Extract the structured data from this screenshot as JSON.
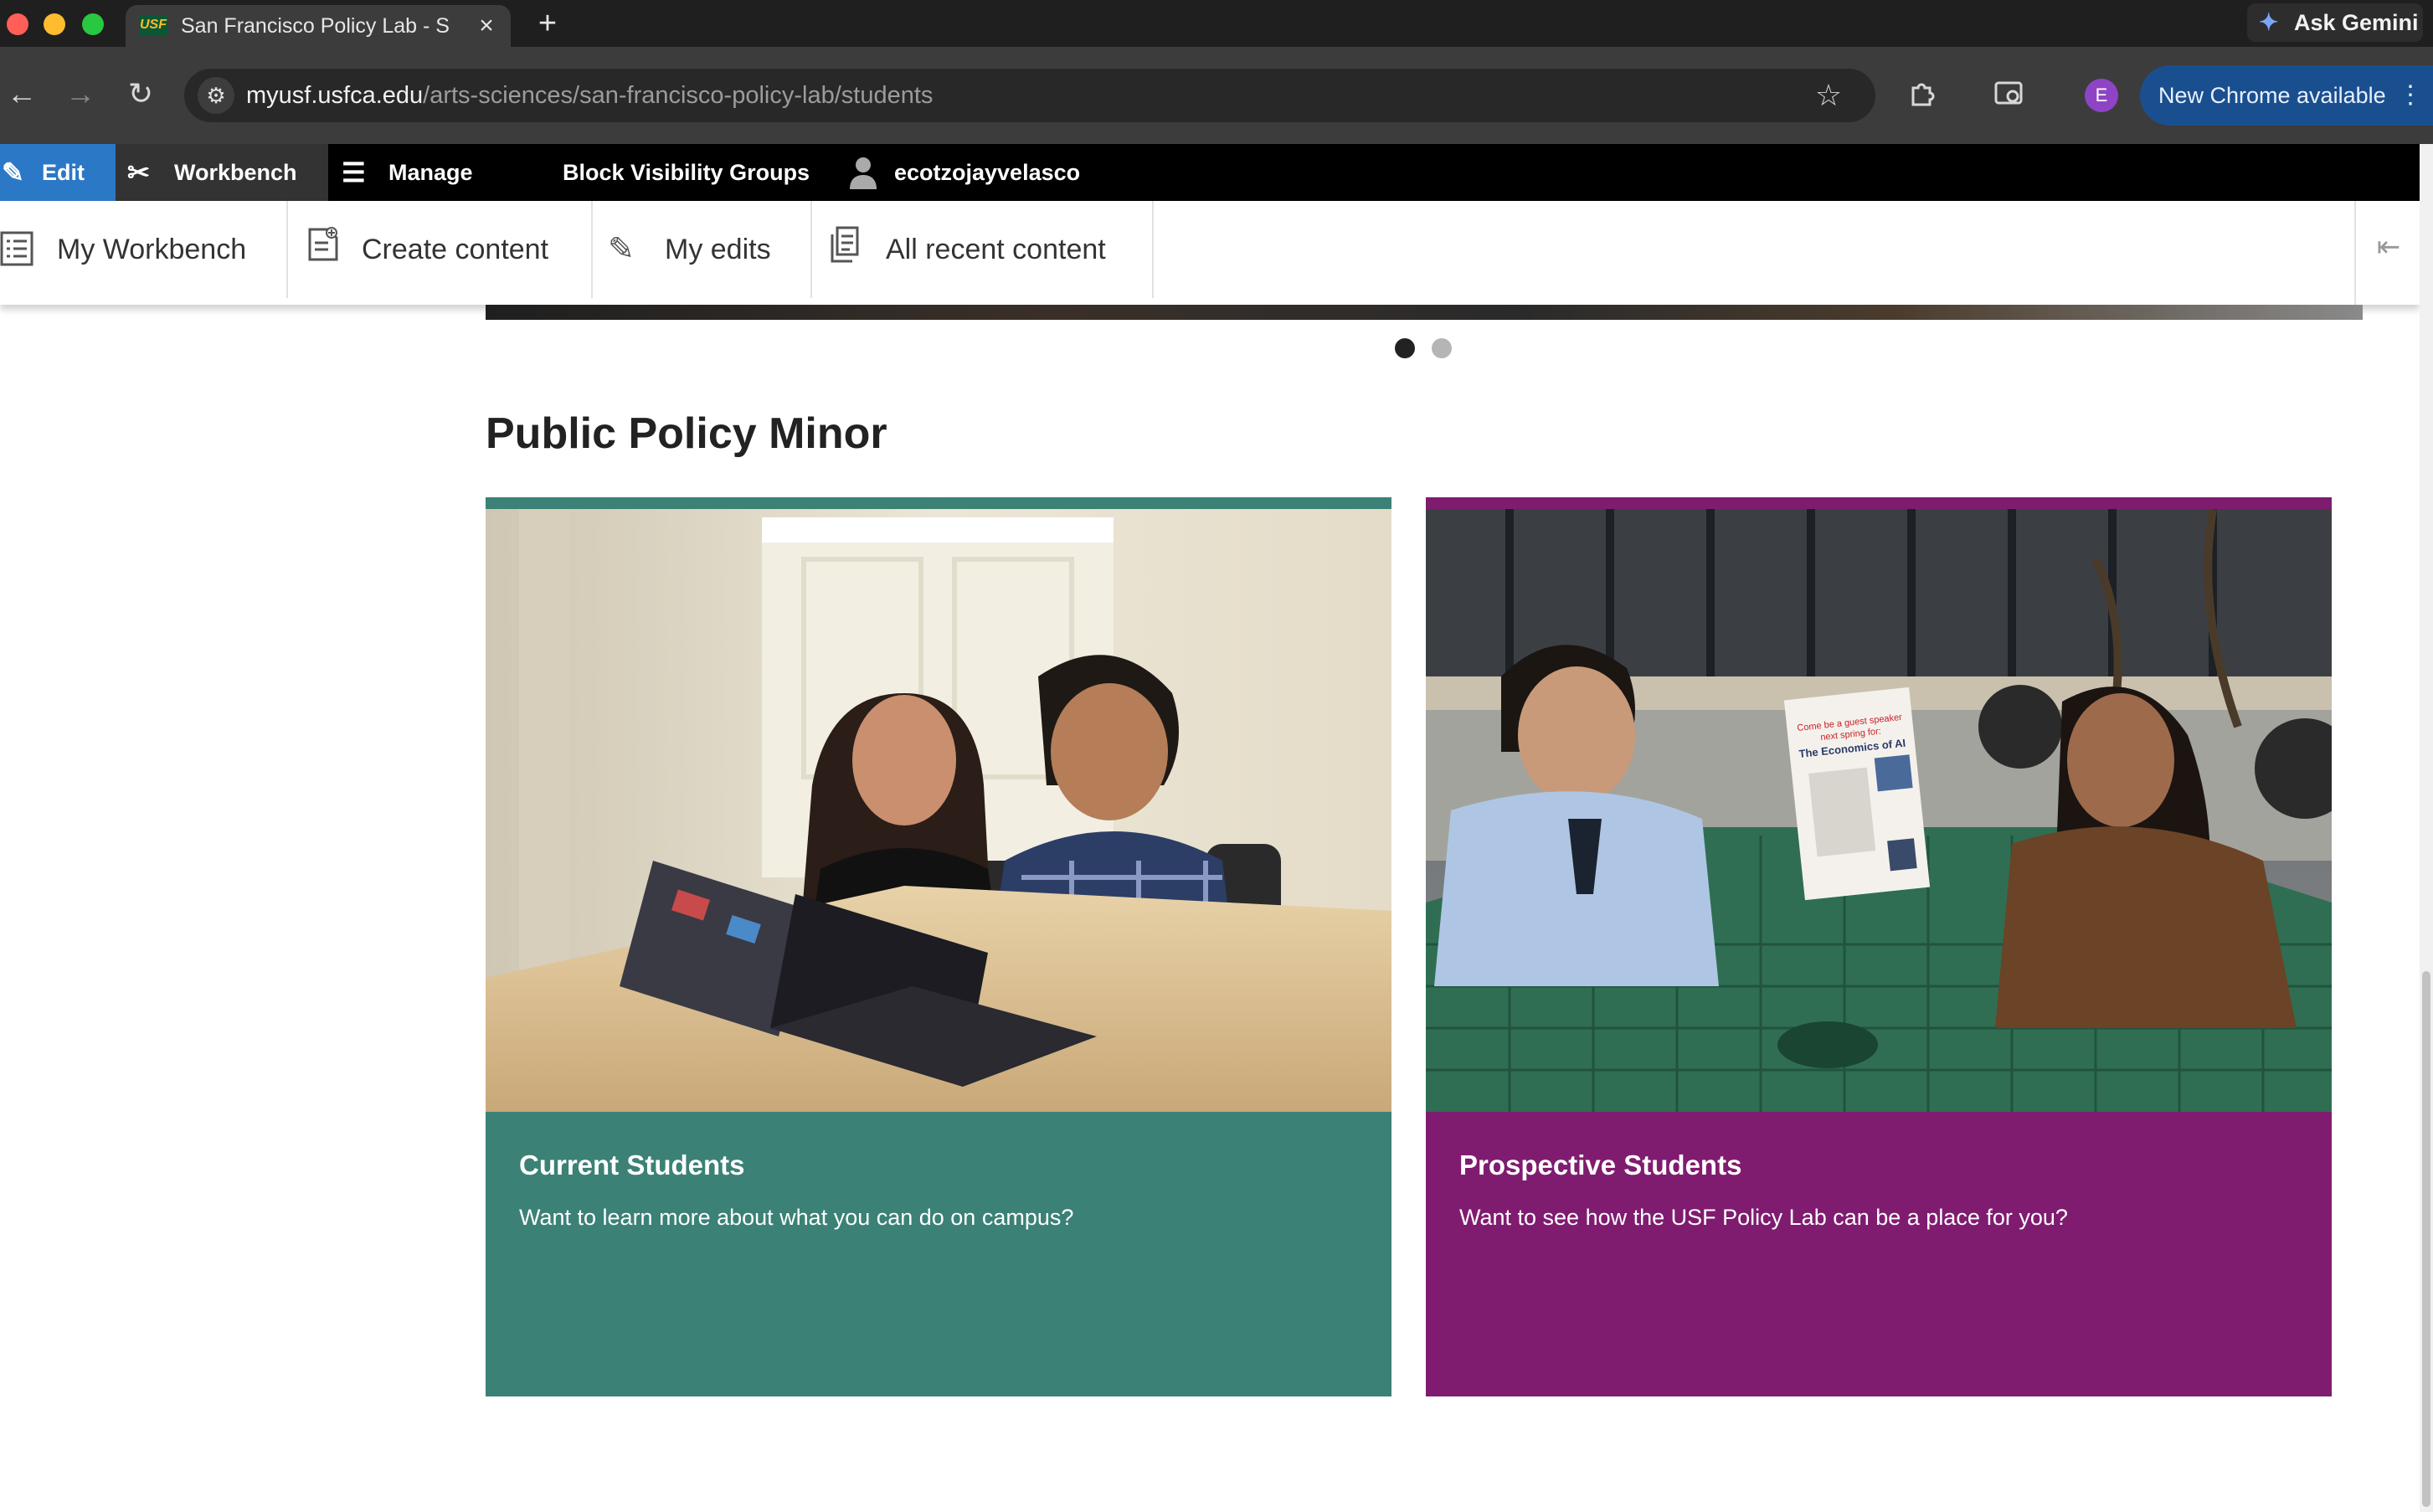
{
  "browser": {
    "tab_title": "San Francisco Policy Lab - Students",
    "tab_favicon_text": "USF",
    "url_host": "myusf.usfca.edu",
    "url_path": "/arts-sciences/san-francisco-policy-lab/students",
    "ask_gemini_label": "Ask Gemini",
    "new_chrome_label": "New Chrome available",
    "profile_initial": "E"
  },
  "admin_toolbar": {
    "edit_label": "Edit",
    "workbench_label": "Workbench",
    "manage_label": "Manage",
    "block_visibility_label": "Block Visibility Groups",
    "user_label": "ecotzojayvelasco"
  },
  "workbench_tray": {
    "my_workbench": "My Workbench",
    "create_content": "Create content",
    "my_edits": "My edits",
    "all_recent_content": "All recent content"
  },
  "page": {
    "section_title": "Public Policy Minor",
    "cards": [
      {
        "heading": "Current Students",
        "text": "Want to learn more about what you can do on campus?",
        "color": "#3b8176"
      },
      {
        "heading": "Prospective Students",
        "text": "Want to see how the USF Policy Lab can be a place for you?",
        "color": "#7f1c70"
      }
    ]
  },
  "poster": {
    "line1": "Come be a guest speaker",
    "line2": "next spring for:",
    "line3": "The Economics of AI"
  },
  "colors": {
    "edit_blue": "#2b78c6",
    "current_teal": "#3b8176",
    "prospective_purple": "#7f1c70"
  }
}
